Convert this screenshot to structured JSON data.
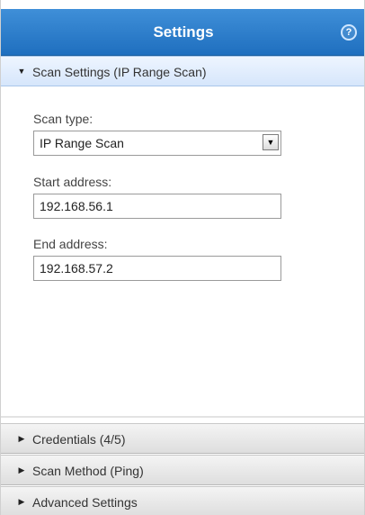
{
  "header": {
    "title": "Settings",
    "help_icon_glyph": "?"
  },
  "sections": {
    "scan_settings": {
      "label": "Scan Settings (IP Range Scan)",
      "arrow": "▼",
      "expanded": true
    },
    "credentials": {
      "label": "Credentials (4/5)",
      "arrow": "▶"
    },
    "scan_method": {
      "label": "Scan Method (Ping)",
      "arrow": "▶"
    },
    "advanced": {
      "label": "Advanced Settings",
      "arrow": "▶"
    }
  },
  "form": {
    "scan_type": {
      "label": "Scan type:",
      "value": "IP Range Scan",
      "dropdown_glyph": "▼"
    },
    "start_address": {
      "label": "Start address:",
      "value": "192.168.56.1"
    },
    "end_address": {
      "label": "End address:",
      "value": "192.168.57.2"
    }
  },
  "colors": {
    "header_blue": "#1f6fbf",
    "active_section": "#d6e6fb"
  }
}
